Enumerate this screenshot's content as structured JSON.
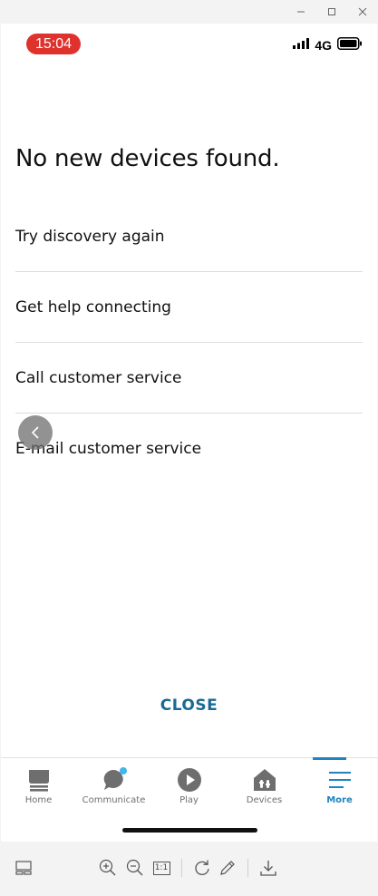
{
  "window": {
    "controls": [
      "minimize-icon",
      "maximize-icon",
      "close-icon"
    ]
  },
  "status_bar": {
    "time": "15:04",
    "network": "4G",
    "time_badge_color": "#e0322d"
  },
  "page": {
    "title": "No new devices found.",
    "options": [
      {
        "label": "Try discovery again"
      },
      {
        "label": "Get help connecting"
      },
      {
        "label": "Call customer service"
      },
      {
        "label": "E-mail customer service"
      }
    ],
    "close_label": "CLOSE"
  },
  "tabs": [
    {
      "label": "Home",
      "icon": "home-icon"
    },
    {
      "label": "Communicate",
      "icon": "communicate-icon"
    },
    {
      "label": "Play",
      "icon": "play-icon"
    },
    {
      "label": "Devices",
      "icon": "devices-icon"
    },
    {
      "label": "More",
      "icon": "menu-icon",
      "active": true
    }
  ],
  "colors": {
    "accent": "#1f84c0",
    "close_text": "#1a6a94",
    "notification_dot": "#3fb6f0"
  },
  "toolbar": {
    "tools": [
      "layout-icon",
      "zoom-in-icon",
      "zoom-out-icon",
      "actual-size-icon",
      "rotate-icon",
      "edit-icon",
      "download-icon"
    ],
    "actual_size_label": "1:1"
  }
}
